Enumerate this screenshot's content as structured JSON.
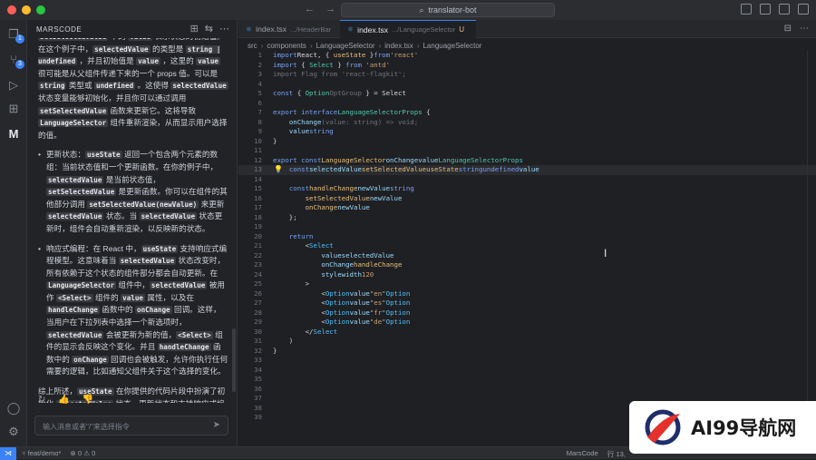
{
  "titlebar": {
    "search": "translator-bot"
  },
  "chat": {
    "header": "MARSCODE",
    "paragraphs_top": [
      {
        "parts": [
          [
            "t",
            "setSelectedValue"
          ],
          [
            "p",
            " 中的 "
          ],
          [
            "c",
            "value"
          ],
          [
            "p",
            " 表示状态的初始值。在这个例子中，"
          ],
          [
            "c",
            "selectedValue"
          ],
          [
            "p",
            " 的类型是 "
          ],
          [
            "c",
            "string | undefined"
          ],
          [
            "p",
            " ，并且初始值是 "
          ],
          [
            "c",
            "value"
          ],
          [
            "p",
            " ，这里的 "
          ],
          [
            "c",
            "value"
          ],
          [
            "p",
            " 很可能是从父组件传递下来的一个 props 值。可以是 "
          ],
          [
            "c",
            "string"
          ],
          [
            "p",
            " 类型或 "
          ],
          [
            "c",
            "undefined"
          ],
          [
            "p",
            " 。这使得 "
          ],
          [
            "c",
            "selectedValue"
          ],
          [
            "p",
            " 状态变量能够初始化，并且你可以通过调用 "
          ],
          [
            "c",
            "setSelectedValue"
          ],
          [
            "p",
            " 函数来更新它。这将导致 "
          ],
          [
            "c",
            "LanguageSelector"
          ],
          [
            "p",
            " 组件重新渲染，从而显示用户选择的值。"
          ]
        ]
      }
    ],
    "bullets": [
      {
        "parts": [
          [
            "p",
            "更新状态："
          ],
          [
            "c",
            "useState"
          ],
          [
            "p",
            " 返回一个包含两个元素的数组：当前状态值和一个更新函数。在你的例子中，"
          ],
          [
            "c",
            "selectedValue"
          ],
          [
            "p",
            " 是当前状态值，"
          ],
          [
            "c",
            "setSelectedValue"
          ],
          [
            "p",
            " 是更新函数。你可以在组件的其他部分调用 "
          ],
          [
            "c",
            "setSelectedValue(newValue)"
          ],
          [
            "p",
            " 来更新 "
          ],
          [
            "c",
            "selectedValue"
          ],
          [
            "p",
            " 状态。当 "
          ],
          [
            "c",
            "selectedValue"
          ],
          [
            "p",
            " 状态更新时，组件会自动重新渲染，以反映新的状态。"
          ]
        ]
      },
      {
        "parts": [
          [
            "p",
            "响应式编程：在 React 中，"
          ],
          [
            "c",
            "useState"
          ],
          [
            "p",
            " 支持响应式编程模型。这意味着当 "
          ],
          [
            "c",
            "selectedValue"
          ],
          [
            "p",
            " 状态改变时，所有依赖于这个状态的组件部分都会自动更新。在 "
          ],
          [
            "c",
            "LanguageSelector"
          ],
          [
            "p",
            " 组件中，"
          ],
          [
            "c",
            "selectedValue"
          ],
          [
            "p",
            " 被用作 "
          ],
          [
            "c",
            "<Select>"
          ],
          [
            "p",
            " 组件的 "
          ],
          [
            "c",
            "value"
          ],
          [
            "p",
            " 属性，以及在 "
          ],
          [
            "c",
            "handleChange"
          ],
          [
            "p",
            " 函数中的 "
          ],
          [
            "c",
            "onChange"
          ],
          [
            "p",
            " 回调。这样，当用户在下拉列表中选择一个新选项时，"
          ],
          [
            "c",
            "selectedValue"
          ],
          [
            "p",
            " 会被更新为新的值，"
          ],
          [
            "c",
            "<Select>"
          ],
          [
            "p",
            " 组件的显示会反映这个变化。并且 "
          ],
          [
            "c",
            "handleChange"
          ],
          [
            "p",
            " 函数中的 "
          ],
          [
            "c",
            "onChange"
          ],
          [
            "p",
            " 回调也会被触发，允许你执行任何需要的逻辑，比如通知父组件关于这个选择的变化。"
          ]
        ]
      }
    ],
    "summary": {
      "parts": [
        [
          "p",
          "综上所述，"
        ],
        [
          "c",
          "useState"
        ],
        [
          "p",
          " 在你提供的代码片段中扮演了初始化 "
        ],
        [
          "c",
          "selectedValue"
        ],
        [
          "p",
          " 状态、更新状态和支持响应式编程的角色，确保了 "
        ],
        [
          "c",
          "LanguageSelector"
        ],
        [
          "p",
          " 组件能够高效、动态地展示和响应下拉列表选择框中的用户交互。"
        ]
      ]
    },
    "input_placeholder": "输入消息或者\"/\"来选择指令"
  },
  "tabs": [
    {
      "name": "index.tsx",
      "path": ".../HeaderBar",
      "active": false
    },
    {
      "name": "index.tsx",
      "path": ".../LanguageSelector",
      "modified": "U",
      "active": true
    }
  ],
  "breadcrumb": [
    "src",
    "components",
    "LanguageSelector",
    "index.tsx",
    "LanguageSelector"
  ],
  "code_lines": [
    [
      [
        "kw",
        "import"
      ],
      [
        "",
        "React, { "
      ],
      [
        "fn",
        "useState"
      ],
      [
        "",
        " }"
      ],
      [
        "kw",
        "from"
      ],
      [
        "str",
        "'react'"
      ]
    ],
    [
      [
        "kw",
        "import"
      ],
      [
        "",
        " { "
      ],
      [
        "ty",
        "Select"
      ],
      [
        "",
        " } "
      ],
      [
        "kw",
        "from"
      ],
      [
        "str",
        " 'antd'"
      ]
    ],
    [
      [
        "cm",
        "import Flag from 'react-flagkit';"
      ]
    ],
    [],
    [
      [
        "kw",
        "const"
      ],
      [
        "",
        " { "
      ],
      [
        "ty",
        "Option"
      ],
      [
        ", "
      ],
      [
        "cm",
        "OptGroup"
      ],
      [
        "",
        " } = Select"
      ]
    ],
    [],
    [
      [
        "kw",
        "export interface"
      ],
      [
        " "
      ],
      [
        "ty",
        "LanguageSelectorProps"
      ],
      [
        "",
        " {"
      ]
    ],
    [
      [
        "",
        "    "
      ],
      [
        "pn",
        "onChange"
      ],
      [
        ": "
      ],
      [
        "cm",
        "(value: string) => void;"
      ]
    ],
    [
      [
        "",
        "    "
      ],
      [
        "pn",
        "value"
      ],
      [
        ": "
      ],
      [
        "kw",
        "string"
      ],
      [
        ";"
      ]
    ],
    [
      [
        "",
        "}"
      ]
    ],
    [],
    [
      [
        "kw",
        "export const"
      ],
      [
        " "
      ],
      [
        "fn",
        "LanguageSelector"
      ],
      [
        " = ({"
      ],
      [
        "pn",
        "onChange"
      ],
      [
        ", "
      ],
      [
        "pn",
        "value"
      ],
      [
        "}: "
      ],
      [
        "ty",
        "LanguageSelectorProps"
      ],
      [
        ") => {"
      ]
    ],
    [
      [
        "",
        "    "
      ],
      [
        "kw",
        "const"
      ],
      [
        " ["
      ],
      [
        "pn",
        "selectedValue"
      ],
      [
        ", "
      ],
      [
        "fn",
        "setSelectedValue"
      ],
      [
        "] = "
      ],
      [
        "fn",
        "useState"
      ],
      [
        "<"
      ],
      [
        "kw",
        "string"
      ],
      [
        " | "
      ],
      [
        "kw",
        "undefined"
      ],
      [
        ">("
      ],
      [
        "pn",
        "value"
      ],
      [
        ");"
      ]
    ],
    [],
    [
      [
        "",
        "    "
      ],
      [
        "kw",
        "const"
      ],
      [
        " "
      ],
      [
        "fn",
        "handleChange"
      ],
      [
        " = ("
      ],
      [
        "pn",
        "newValue"
      ],
      [
        ": "
      ],
      [
        "kw",
        "string"
      ],
      [
        ") => {"
      ]
    ],
    [
      [
        "",
        "        "
      ],
      [
        "fn",
        "setSelectedValue"
      ],
      [
        "("
      ],
      [
        "pn",
        "newValue"
      ],
      [
        ");"
      ]
    ],
    [
      [
        "",
        "        "
      ],
      [
        "fn",
        "onChange"
      ],
      [
        "("
      ],
      [
        "pn",
        "newValue"
      ],
      [
        ");"
      ]
    ],
    [
      [
        "",
        "    };"
      ]
    ],
    [],
    [
      [
        "",
        "    "
      ],
      [
        "kw",
        "return"
      ],
      [
        " ("
      ]
    ],
    [
      [
        "",
        "        <"
      ],
      [
        "tg",
        "Select"
      ]
    ],
    [
      [
        "",
        "            "
      ],
      [
        "at",
        "value"
      ],
      [
        "={"
      ],
      [
        "pn",
        "selectedValue"
      ],
      [
        "}"
      ]
    ],
    [
      [
        "",
        "            "
      ],
      [
        "at",
        "onChange"
      ],
      [
        "={"
      ],
      [
        "fn",
        "handleChange"
      ],
      [
        "}"
      ]
    ],
    [
      [
        "",
        "            "
      ],
      [
        "at",
        "style"
      ],
      [
        "={{ "
      ],
      [
        "pn",
        "width"
      ],
      [
        ": "
      ],
      [
        "str",
        "120"
      ],
      [
        " }}"
      ]
    ],
    [
      [
        "",
        "        >"
      ]
    ],
    [
      [
        "",
        "            <"
      ],
      [
        "tg",
        "Option"
      ],
      [
        " "
      ],
      [
        "at",
        "value"
      ],
      [
        "="
      ],
      [
        "str",
        "\"en\""
      ],
      [
        ">英语</"
      ],
      [
        "tg",
        "Option"
      ],
      [
        ">"
      ]
    ],
    [
      [
        "",
        "            <"
      ],
      [
        "tg",
        "Option"
      ],
      [
        " "
      ],
      [
        "at",
        "value"
      ],
      [
        "="
      ],
      [
        "str",
        "\"es\""
      ],
      [
        ">西班牙语</"
      ],
      [
        "tg",
        "Option"
      ],
      [
        ">"
      ]
    ],
    [
      [
        "",
        "            <"
      ],
      [
        "tg",
        "Option"
      ],
      [
        " "
      ],
      [
        "at",
        "value"
      ],
      [
        "="
      ],
      [
        "str",
        "\"fr\""
      ],
      [
        ">法语</"
      ],
      [
        "tg",
        "Option"
      ],
      [
        ">"
      ]
    ],
    [
      [
        "",
        "            <"
      ],
      [
        "tg",
        "Option"
      ],
      [
        " "
      ],
      [
        "at",
        "value"
      ],
      [
        "="
      ],
      [
        "str",
        "\"de\""
      ],
      [
        ">德语</"
      ],
      [
        "tg",
        "Option"
      ],
      [
        ">"
      ]
    ],
    [
      [
        "",
        "        </"
      ],
      [
        "tg",
        "Select"
      ],
      [
        ">"
      ]
    ],
    [
      [
        "",
        "    )"
      ]
    ],
    [
      [
        "",
        "}"
      ]
    ],
    [],
    [],
    [],
    [],
    [],
    [],
    []
  ],
  "current_line": 13,
  "statusbar": {
    "branch": "feat/demo*",
    "sync": "0 ⚠ 0",
    "right": "MarsCode",
    "position": "行 13,"
  },
  "watermark": {
    "text": "AI99导航网"
  },
  "colors": {
    "accent": "#3b82f6",
    "background": "#1e1f22"
  }
}
